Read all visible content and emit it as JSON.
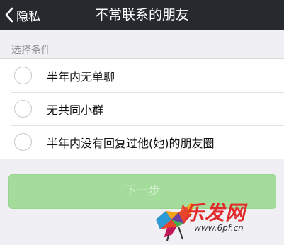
{
  "navbar": {
    "back_label": "隐私",
    "title": "不常联系的朋友",
    "background": "#262a2f"
  },
  "section": {
    "header": "选择条件"
  },
  "options": [
    {
      "label": "半年内无单聊",
      "selected": false
    },
    {
      "label": "无共同小群",
      "selected": false
    },
    {
      "label": "半年内没有回复过他(她)的朋友圈",
      "selected": false
    }
  ],
  "next_button": {
    "label": "下一步",
    "enabled": false,
    "color": "#a4dc9c"
  },
  "watermark": {
    "text": "乐发网",
    "url": "www.6pf.cn"
  },
  "icons": {
    "back": "chevron-left-icon",
    "watermark": "bull-logo-icon"
  }
}
